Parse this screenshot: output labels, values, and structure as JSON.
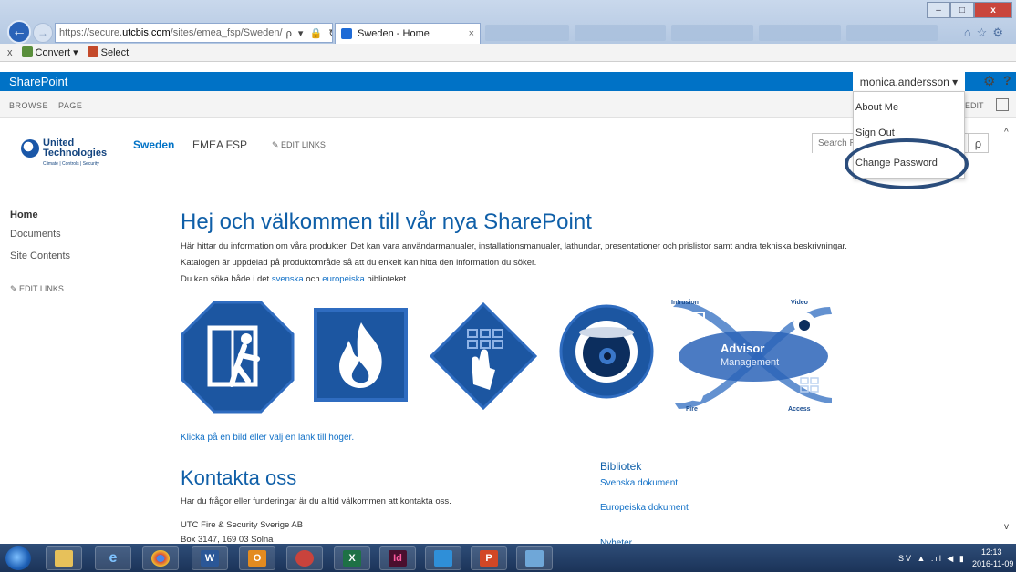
{
  "browser": {
    "url_prefix": "https://secure.",
    "url_domain": "utcbis.com",
    "url_path": "/sites/emea_fsp/Sweden/",
    "addr_icons": "ρ ▾ 🔒 ↻",
    "active_tab_title": "Sweden - Home",
    "active_tab_close": "×",
    "back": "←",
    "forward": "→",
    "win_min": "–",
    "win_max": "□",
    "win_close": "x",
    "chrome_right": "⌂☆⚙"
  },
  "command_bar": {
    "close": "x",
    "convert_label": "Convert",
    "convert_arrow": "▾",
    "select_label": "Select"
  },
  "suitebar": {
    "brand": "SharePoint",
    "user": "monica.andersson ▾",
    "gear": "⚙",
    "help": "?"
  },
  "ribbon": {
    "browse": "BROWSE",
    "page": "PAGE",
    "edit": "EDIT"
  },
  "user_menu": {
    "about": "About Me",
    "signout": "Sign Out",
    "change_password": "Change Password"
  },
  "header": {
    "logo_name": "United Technologies",
    "logo_tagline": "Climate | Controls | Security",
    "nav_sweden": "Sweden",
    "nav_emea": "EMEA FSP",
    "nav_edit": "✎  EDIT LINKS",
    "search_placeholder": "Search R",
    "search_icon": "ρ"
  },
  "leftnav": {
    "home": "Home",
    "documents": "Documents",
    "site_contents": "Site Contents",
    "edit_links": "✎  EDIT LINKS"
  },
  "main": {
    "title": "Hej och välkommen till vår nya SharePoint",
    "line1": "Här hittar du information om våra produkter. Det kan vara användarmanualer, installationsmanualer, lathundar, presentationer och prislistor samt andra tekniska beskrivningar.",
    "line2": "Katalogen är uppdelad på produktområde så att du enkelt kan hitta den information du söker.",
    "line3_a": "Du kan söka både i det ",
    "line3_link1": "svenska",
    "line3_b": " och ",
    "line3_link2": "europeiska",
    "line3_c": " biblioteket.",
    "click_hint": "Klicka på en bild eller välj en länk till höger.",
    "contact_title": "Kontakta oss",
    "contact_text": "Har du frågor eller funderingar är du alltid välkommen att kontakta oss.",
    "contact_addr1": "UTC Fire & Security Sverige AB",
    "contact_addr2": "Box 3147,  169 03 Solna"
  },
  "advisor": {
    "title": "Advisor",
    "sub": "Management",
    "intrusion": "Intrusion",
    "video": "Video",
    "fire": "Fire",
    "access": "Access"
  },
  "library": {
    "title": "Bibliotek",
    "link_sv": "Svenska dokument",
    "link_eu": "Europeiska dokument",
    "partial": "Nyheter"
  },
  "scroll": {
    "up": "^",
    "down": "v"
  },
  "taskbar": {
    "apps": [
      "",
      "",
      "e",
      "",
      "W",
      "O",
      "",
      "X",
      "Id",
      "",
      "P",
      ""
    ],
    "tray": "SV  ▲  .ıl  ◀  ▮",
    "time": "12:13",
    "date": "2016-11-09"
  },
  "colors": {
    "sharepoint_blue": "#0072c6",
    "title_blue": "#0f5fa8",
    "link_blue": "#0f6fc6",
    "ring": "#2b4d7c"
  }
}
